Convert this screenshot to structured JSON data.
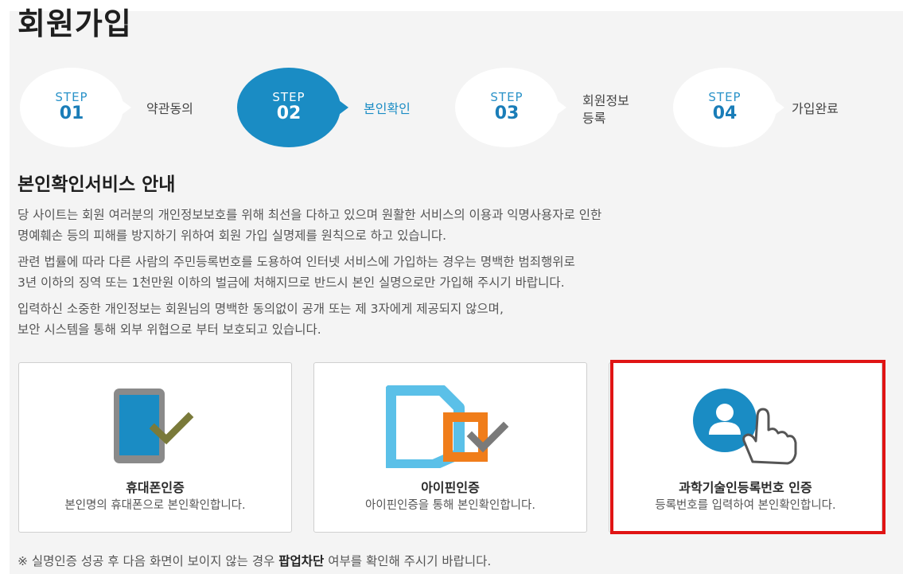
{
  "page": {
    "title": "회원가입"
  },
  "steps": [
    {
      "word": "STEP",
      "num": "01",
      "label": "약관동의",
      "active": false
    },
    {
      "word": "STEP",
      "num": "02",
      "label": "본인확인",
      "active": true
    },
    {
      "word": "STEP",
      "num": "03",
      "label_line1": "회원정보",
      "label_line2": "등록",
      "active": false
    },
    {
      "word": "STEP",
      "num": "04",
      "label": "가입완료",
      "active": false
    }
  ],
  "section": {
    "title": "본인확인서비스 안내",
    "paragraphs": [
      [
        "당 사이트는 회원 여러분의 개인정보보호를 위해 최선을 다하고 있으며 원활한 서비스의 이용과 익명사용자로 인한",
        "명예훼손 등의 피해를 방지하기 위하여 회원 가입 실명제를 원칙으로 하고 있습니다."
      ],
      [
        "관련 법률에 따라 다른 사람의 주민등록번호를 도용하여 인터넷 서비스에 가입하는 경우는 명백한 범죄행위로",
        "3년 이하의 징역 또는 1천만원 이하의 벌금에 처해지므로 반드시 본인 실명으로만 가입해 주시기 바랍니다."
      ],
      [
        "입력하신 소중한 개인정보는 회원님의 명백한 동의없이 공개 또는 제 3자에게 제공되지 않으며,",
        "보안 시스템을 통해 외부 위협으로 부터 보호되고 있습니다."
      ]
    ]
  },
  "cards": [
    {
      "icon": "phone-check-icon",
      "title": "휴대폰인증",
      "desc": "본인명의 휴대폰으로 본인확인합니다."
    },
    {
      "icon": "ipin-check-icon",
      "title": "아이핀인증",
      "desc": "아이핀인증을 통해 본인확인합니다."
    },
    {
      "icon": "user-touch-icon",
      "title": "과학기술인등록번호 인증",
      "desc": "등록번호를 입력하여 본인확인합니다."
    }
  ],
  "notice": {
    "prefix": "※ 실명인증 성공 후 다음 화면이 보이지 않는 경우 ",
    "bold": "팝업차단",
    "suffix": " 여부를 확인해 주시기 바랍니다."
  },
  "colors": {
    "accent": "#1a8cc4",
    "highlight": "#e01414",
    "ipin_orange": "#f07d1a",
    "ipin_blue": "#5bc0e8",
    "check_olive": "#7a7a3a"
  }
}
